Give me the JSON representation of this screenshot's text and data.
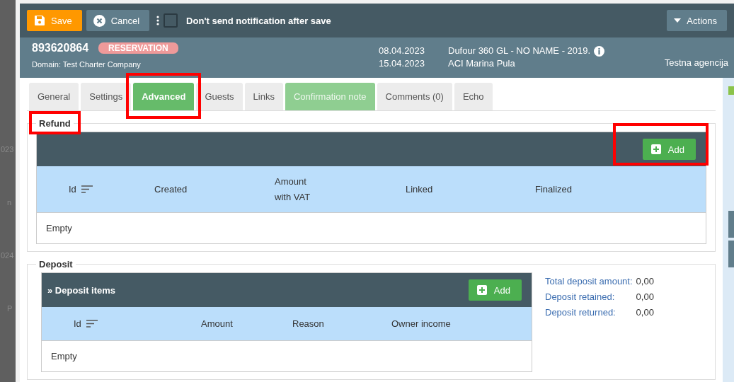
{
  "backdrop": {
    "fragments": [
      "023",
      "n",
      "024",
      "P"
    ]
  },
  "toolbar": {
    "save": "Save",
    "cancel": "Cancel",
    "notify_checkbox": {
      "label": "Don't send notification after save",
      "checked": false
    },
    "actions": "Actions"
  },
  "header": {
    "number": "893620864",
    "badge": "RESERVATION",
    "domain": "Domain: Test Charter Company",
    "date_from": "08.04.2023",
    "date_to": "15.04.2023",
    "boat": "Dufour 360 GL - NO NAME - 2019.",
    "marina": "ACI Marina Pula",
    "agency": "Testna agencija"
  },
  "tabs": [
    {
      "label": "General",
      "selected": false,
      "kind": "plain",
      "highlighted": false
    },
    {
      "label": "Settings",
      "selected": false,
      "kind": "plain",
      "highlighted": false
    },
    {
      "label": "Advanced",
      "selected": true,
      "kind": "green",
      "highlighted": true
    },
    {
      "label": "Guests",
      "selected": false,
      "kind": "plain",
      "highlighted": false
    },
    {
      "label": "Links",
      "selected": false,
      "kind": "plain",
      "highlighted": false
    },
    {
      "label": "Confirmation note",
      "selected": false,
      "kind": "lightgreen",
      "highlighted": false
    },
    {
      "label": "Comments (0)",
      "selected": false,
      "kind": "plain",
      "highlighted": false
    },
    {
      "label": "Echo",
      "selected": false,
      "kind": "plain",
      "highlighted": false
    }
  ],
  "refund": {
    "legend": "Refund",
    "legend_highlighted": true,
    "add_button": "Add",
    "add_highlighted": true,
    "columns": [
      {
        "label": "Id",
        "sortable": true
      },
      {
        "label": "Created",
        "sortable": false
      },
      {
        "label": "Amount\nwith VAT",
        "sortable": false
      },
      {
        "label": "Linked",
        "sortable": false
      },
      {
        "label": "Finalized",
        "sortable": false
      }
    ],
    "empty": "Empty"
  },
  "deposit": {
    "legend": "Deposit",
    "table_title": "» Deposit items",
    "add_button": "Add",
    "columns": [
      {
        "label": "Id",
        "sortable": true
      },
      {
        "label": "Amount",
        "sortable": false
      },
      {
        "label": "Reason",
        "sortable": false
      },
      {
        "label": "Owner income",
        "sortable": false
      }
    ],
    "empty": "Empty",
    "summary": [
      {
        "label": "Total deposit amount:",
        "value": "0,00"
      },
      {
        "label": "Deposit retained:",
        "value": "0,00"
      },
      {
        "label": "Deposit returned:",
        "value": "0,00"
      }
    ]
  }
}
